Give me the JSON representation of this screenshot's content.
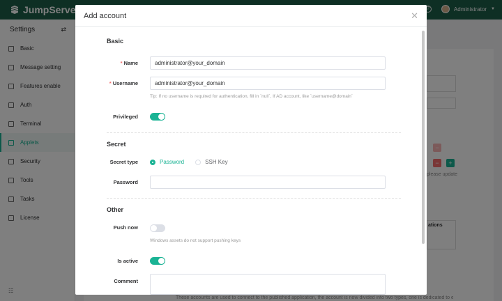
{
  "app": {
    "brand": "JumpServer",
    "user": "Administrator"
  },
  "sidebar": {
    "title": "Settings",
    "items": [
      {
        "label": "Basic"
      },
      {
        "label": "Message setting"
      },
      {
        "label": "Features enable"
      },
      {
        "label": "Auth"
      },
      {
        "label": "Terminal"
      },
      {
        "label": "Applets"
      },
      {
        "label": "Security"
      },
      {
        "label": "Tools"
      },
      {
        "label": "Tasks"
      },
      {
        "label": "License"
      }
    ],
    "active": "Applets"
  },
  "background": {
    "update_text": "please update",
    "col_header": "ations",
    "footer_text": "These accounts are used to connect to the published application, the account is now divided into two types, one is dedicated to each"
  },
  "modal": {
    "title": "Add account",
    "basic": {
      "section": "Basic",
      "name_label": "Name",
      "name_value": "administrator@your_domain",
      "username_label": "Username",
      "username_value": "administrator@your_domain",
      "username_tip": "Tip: If no username is required for authentication, fill in `null`, If AD account, like `username@domain`",
      "privileged_label": "Privileged",
      "privileged": true
    },
    "secret": {
      "section": "Secret",
      "type_label": "Secret type",
      "types": [
        "Password",
        "SSH Key"
      ],
      "selected_type": "Password",
      "password_label": "Password",
      "password_value": ""
    },
    "other": {
      "section": "Other",
      "push_label": "Push now",
      "push_now": false,
      "push_tip": "Windows assets do not support pushing keys",
      "active_label": "Is active",
      "is_active": true,
      "comment_label": "Comment",
      "comment_value": ""
    }
  },
  "colors": {
    "brand": "#1c5e49",
    "accent": "#1ab394",
    "danger": "#f56c6c"
  },
  "icons": {
    "logo": "jumpserver-logo-icon",
    "close": "close-icon",
    "help": "help-circle-icon",
    "collapse": "collapse-arrows-icon"
  }
}
